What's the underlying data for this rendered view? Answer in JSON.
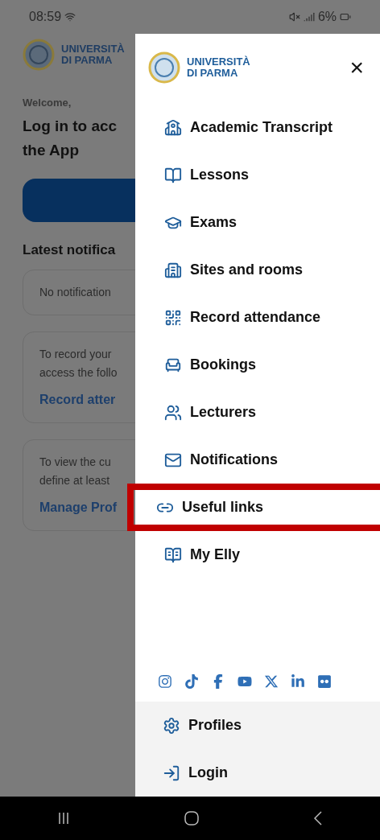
{
  "status_bar": {
    "time": "08:59",
    "battery": "6%"
  },
  "background_page": {
    "logo_lines": [
      "UNIVERSITÀ",
      "DI PARMA"
    ],
    "welcome": "Welcome,",
    "title_lines": [
      "Log in to acc",
      "the App"
    ],
    "section_title": "Latest notifica",
    "cards": [
      {
        "lines": [
          "No notification"
        ]
      },
      {
        "lines": [
          "To record your",
          "access the follo"
        ],
        "link": "Record atter"
      },
      {
        "lines": [
          "To view the cu",
          "define at least"
        ],
        "link": "Manage Prof"
      }
    ]
  },
  "drawer": {
    "logo_lines": [
      "UNIVERSITÀ",
      "DI PARMA"
    ],
    "close": "×",
    "items": [
      {
        "label": "Academic Transcript",
        "highlighted": false
      },
      {
        "label": "Lessons",
        "highlighted": false
      },
      {
        "label": "Exams",
        "highlighted": false
      },
      {
        "label": "Sites and rooms",
        "highlighted": false
      },
      {
        "label": "Record attendance",
        "highlighted": false
      },
      {
        "label": "Bookings",
        "highlighted": false
      },
      {
        "label": "Lecturers",
        "highlighted": false
      },
      {
        "label": "Notifications",
        "highlighted": false
      },
      {
        "label": "Useful links",
        "highlighted": true
      },
      {
        "label": "My Elly",
        "highlighted": false
      }
    ],
    "footer_items": [
      {
        "label": "Profiles"
      },
      {
        "label": "Login"
      }
    ]
  }
}
